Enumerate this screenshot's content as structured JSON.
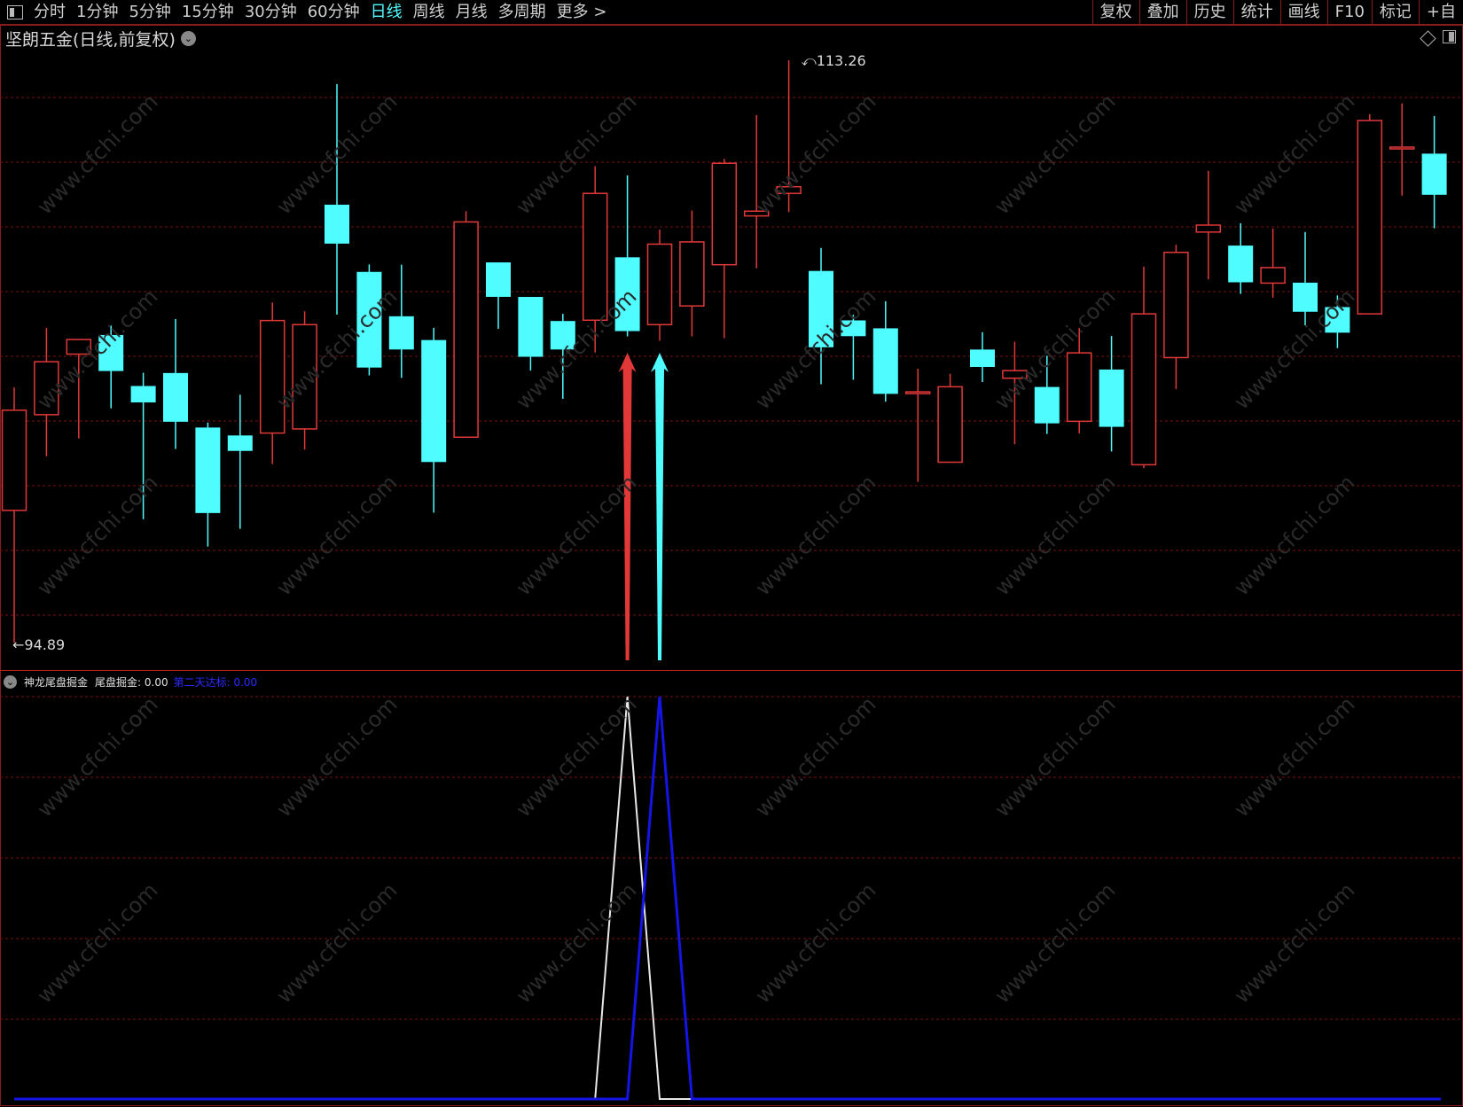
{
  "toolbar": {
    "periods": [
      "分时",
      "1分钟",
      "5分钟",
      "15分钟",
      "30分钟",
      "60分钟",
      "日线",
      "周线",
      "月线",
      "多周期",
      "更多 >"
    ],
    "active_period": "日线",
    "right_buttons": [
      "复权",
      "叠加",
      "历史",
      "统计",
      "画线",
      "F10",
      "标记",
      "+自"
    ]
  },
  "title": "坚朗五金(日线,前复权)",
  "price_labels": {
    "high": "113.26",
    "low": "94.89"
  },
  "indicator": {
    "name": "神龙尾盘掘金",
    "series1": "尾盘掘金: 0.00",
    "series2": "第二天达标: 0.00"
  },
  "watermark": "www.cfchi.com",
  "colors": {
    "up": "#e23838",
    "down": "#4ffcff",
    "grid": "#7a1010",
    "s1": "#e8e8e8",
    "s2": "#1414e6"
  },
  "chart_data": {
    "type": "candlestick",
    "price_range": [
      94.89,
      113.26
    ],
    "candles": [
      {
        "o": 99.06,
        "c": 102.22,
        "h": 102.94,
        "l": 94.89
      },
      {
        "o": 102.08,
        "c": 103.75,
        "h": 104.82,
        "l": 100.77
      },
      {
        "o": 103.99,
        "c": 104.45,
        "h": 104.46,
        "l": 101.33
      },
      {
        "o": 104.58,
        "c": 103.47,
        "h": 104.89,
        "l": 102.28
      },
      {
        "o": 102.97,
        "c": 102.48,
        "h": 103.4,
        "l": 98.78
      },
      {
        "o": 103.38,
        "c": 101.87,
        "h": 105.1,
        "l": 101.0
      },
      {
        "o": 101.66,
        "c": 98.99,
        "h": 101.83,
        "l": 97.92
      },
      {
        "o": 101.41,
        "c": 100.95,
        "h": 102.71,
        "l": 98.48
      },
      {
        "o": 101.5,
        "c": 105.05,
        "h": 105.62,
        "l": 100.52
      },
      {
        "o": 101.63,
        "c": 104.92,
        "h": 105.34,
        "l": 100.98
      },
      {
        "o": 108.69,
        "c": 107.49,
        "h": 112.51,
        "l": 105.24
      },
      {
        "o": 106.57,
        "c": 103.58,
        "h": 106.82,
        "l": 103.32
      },
      {
        "o": 105.17,
        "c": 104.15,
        "h": 106.81,
        "l": 103.24
      },
      {
        "o": 104.42,
        "c": 100.6,
        "h": 104.82,
        "l": 98.99
      },
      {
        "o": 101.37,
        "c": 108.16,
        "h": 108.5,
        "l": 101.37
      },
      {
        "o": 106.87,
        "c": 105.81,
        "h": 106.82,
        "l": 104.79
      },
      {
        "o": 105.78,
        "c": 103.92,
        "h": 105.79,
        "l": 103.47
      },
      {
        "o": 105.02,
        "c": 104.15,
        "h": 105.26,
        "l": 102.58
      },
      {
        "o": 105.06,
        "c": 109.06,
        "h": 109.92,
        "l": 104.04
      },
      {
        "o": 107.03,
        "c": 104.73,
        "h": 109.63,
        "l": 104.55
      },
      {
        "o": 104.92,
        "c": 107.46,
        "h": 107.92,
        "l": 104.41
      },
      {
        "o": 105.51,
        "c": 107.53,
        "h": 108.52,
        "l": 104.55
      },
      {
        "o": 106.81,
        "c": 110.01,
        "h": 110.15,
        "l": 104.49
      },
      {
        "o": 108.35,
        "c": 108.5,
        "h": 111.53,
        "l": 106.7
      },
      {
        "o": 109.06,
        "c": 109.27,
        "h": 113.26,
        "l": 108.47
      },
      {
        "o": 106.6,
        "c": 104.22,
        "h": 107.34,
        "l": 103.04
      },
      {
        "o": 105.04,
        "c": 104.57,
        "h": 105.23,
        "l": 103.18
      },
      {
        "o": 104.79,
        "c": 102.75,
        "h": 105.66,
        "l": 102.49
      },
      {
        "o": 102.8,
        "c": 102.8,
        "h": 103.53,
        "l": 99.96
      },
      {
        "o": 100.58,
        "c": 102.96,
        "h": 103.37,
        "l": 100.58
      },
      {
        "o": 104.12,
        "c": 103.6,
        "h": 104.68,
        "l": 103.11
      },
      {
        "o": 103.23,
        "c": 103.47,
        "h": 104.38,
        "l": 101.15
      },
      {
        "o": 102.94,
        "c": 101.82,
        "h": 103.94,
        "l": 101.47
      },
      {
        "o": 101.87,
        "c": 104.03,
        "h": 104.81,
        "l": 101.49
      },
      {
        "o": 103.49,
        "c": 101.71,
        "h": 104.56,
        "l": 100.92
      },
      {
        "o": 100.5,
        "c": 105.26,
        "h": 106.75,
        "l": 100.39
      },
      {
        "o": 103.88,
        "c": 107.2,
        "h": 107.44,
        "l": 102.89
      },
      {
        "o": 107.84,
        "c": 108.06,
        "h": 109.77,
        "l": 106.35
      },
      {
        "o": 107.4,
        "c": 106.27,
        "h": 108.12,
        "l": 105.89
      },
      {
        "o": 106.23,
        "c": 106.72,
        "h": 107.95,
        "l": 105.77
      },
      {
        "o": 106.23,
        "c": 105.34,
        "h": 107.84,
        "l": 104.9
      },
      {
        "o": 105.46,
        "c": 104.68,
        "h": 105.84,
        "l": 104.18
      },
      {
        "o": 105.26,
        "c": 111.36,
        "h": 111.56,
        "l": 105.26
      },
      {
        "o": 110.52,
        "c": 110.52,
        "h": 111.9,
        "l": 108.99
      },
      {
        "o": 110.3,
        "c": 109.03,
        "h": 111.5,
        "l": 107.96
      }
    ],
    "indicator_values": {
      "x_positions_index": [
        18.5,
        19.5,
        20.5
      ],
      "series1": {
        "name": "尾盘掘金",
        "peak_index": 19,
        "peak_value": 1
      },
      "series2": {
        "name": "第二天达标",
        "peak_index": 20,
        "peak_value": 1
      }
    },
    "arrows": [
      {
        "index": 19,
        "color": "up"
      },
      {
        "index": 20,
        "color": "down"
      }
    ]
  }
}
